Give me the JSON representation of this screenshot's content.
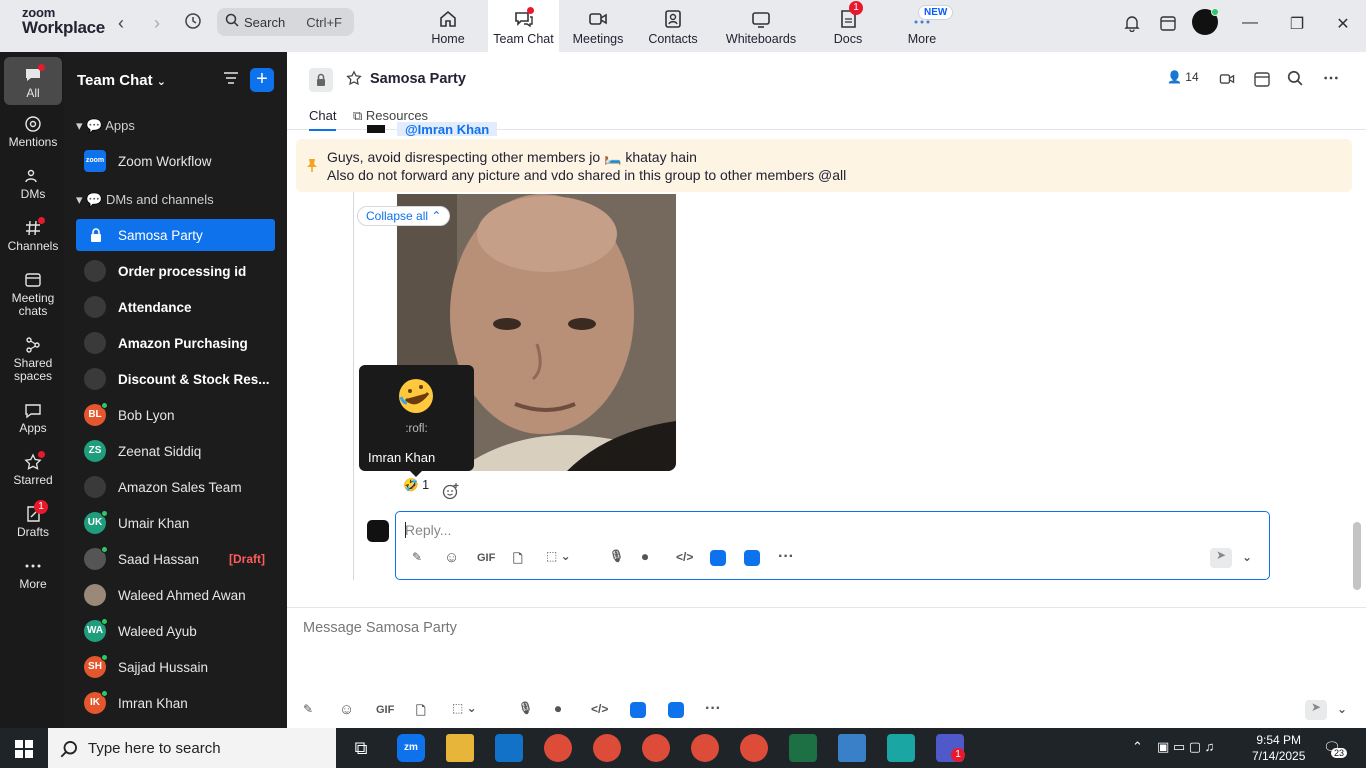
{
  "topbar": {
    "logo_line1": "zoom",
    "logo_line2": "Workplace",
    "search_label": "Search",
    "search_shortcut": "Ctrl+F",
    "tabs": [
      {
        "label": "Home",
        "icon": "home-icon"
      },
      {
        "label": "Team Chat",
        "icon": "chat-icon"
      },
      {
        "label": "Meetings",
        "icon": "video-icon"
      },
      {
        "label": "Contacts",
        "icon": "contacts-icon"
      },
      {
        "label": "Whiteboards",
        "icon": "whiteboard-icon"
      },
      {
        "label": "Docs",
        "icon": "docs-icon"
      },
      {
        "label": "More",
        "icon": "more-dots-icon"
      }
    ],
    "docs_badge": "1",
    "new_badge": "NEW"
  },
  "rail": {
    "items": [
      {
        "label": "All"
      },
      {
        "label": "Mentions"
      },
      {
        "label": "DMs"
      },
      {
        "label": "Channels"
      },
      {
        "label": "Meeting chats"
      },
      {
        "label": "Shared spaces"
      },
      {
        "label": "Apps"
      },
      {
        "label": "Starred"
      },
      {
        "label": "Drafts"
      },
      {
        "label": "More"
      }
    ],
    "drafts_badge": "1"
  },
  "sidebar": {
    "title": "Team Chat",
    "sections": {
      "apps": "Apps",
      "dms": "DMs and channels"
    },
    "app_item": "Zoom Workflow",
    "items": [
      {
        "label": "Samosa Party"
      },
      {
        "label": "Order processing id"
      },
      {
        "label": "Attendance"
      },
      {
        "label": "Amazon Purchasing"
      },
      {
        "label": "Discount & Stock Res..."
      },
      {
        "label": "Bob Lyon",
        "initials": "BL"
      },
      {
        "label": "Zeenat Siddiq",
        "initials": "ZS"
      },
      {
        "label": "Amazon Sales Team"
      },
      {
        "label": "Umair Khan",
        "initials": "UK"
      },
      {
        "label": "Saad Hassan",
        "draft": "[Draft]"
      },
      {
        "label": "Waleed Ahmed Awan"
      },
      {
        "label": "Waleed Ayub",
        "initials": "WA"
      },
      {
        "label": "Sajjad Hussain",
        "initials": "SH"
      },
      {
        "label": "Imran Khan",
        "initials": "IK"
      }
    ],
    "colors": {
      "BL": "#e4562d",
      "ZS": "#1f9e7d",
      "UK": "#1f9e7d",
      "WA": "#1f9e7d",
      "SH": "#e4562d",
      "IK": "#e4562d"
    }
  },
  "chat": {
    "title": "Samosa Party",
    "member_count": "14",
    "tabs": [
      "Chat",
      "Resources"
    ],
    "mention_text": "@Imran Khan",
    "pinned_line1": "Guys, avoid disrespecting other members jo 🛏️ khatay hain",
    "pinned_line2": "Also do not forward any picture and vdo shared in this group to other members @all",
    "collapse_label": "Collapse all",
    "tooltip_code": ":rofl:",
    "tooltip_user": "Imran Khan",
    "reaction_emoji": "🤣",
    "reaction_count": "1",
    "reply_placeholder": "Reply...",
    "composer_placeholder": "Message Samosa Party",
    "gif_label": "GIF"
  },
  "taskbar": {
    "search_placeholder": "Type here to search",
    "time": "9:54 PM",
    "date": "7/14/2025",
    "notifications": "23",
    "teams_badge": "1"
  },
  "accent_color": "#0e72ed"
}
